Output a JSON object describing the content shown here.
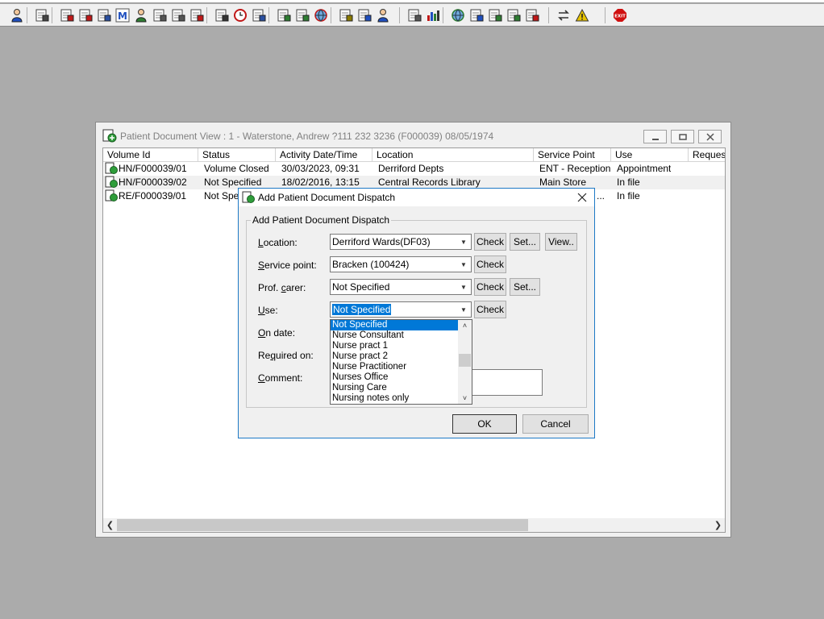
{
  "toolbar": {
    "icons": [
      {
        "name": "patient-icon",
        "color": "#1f4fbf"
      },
      {
        "name": "printer-icon",
        "color": "#444444"
      },
      {
        "name": "red-book-icon",
        "color": "#c01818"
      },
      {
        "name": "folder-icon",
        "color": "#c01818"
      },
      {
        "name": "search-document-icon",
        "color": "#2a4fa0"
      },
      {
        "name": "letter-m-icon",
        "color": "#1f4fbf"
      },
      {
        "name": "person-icon",
        "color": "#2e7d32"
      },
      {
        "name": "edit-document-icon",
        "color": "#555555"
      },
      {
        "name": "transfer-icon",
        "color": "#555555"
      },
      {
        "name": "transfer-red-icon",
        "color": "#c01818"
      },
      {
        "name": "search-icon",
        "color": "#333333"
      },
      {
        "name": "clock-icon",
        "color": "#c01818"
      },
      {
        "name": "screen-icon",
        "color": "#2a4fa0"
      },
      {
        "name": "printer-green-icon",
        "color": "#2e7d32"
      },
      {
        "name": "form-icon",
        "color": "#2e7d32"
      },
      {
        "name": "globe-icon",
        "color": "#c01818"
      },
      {
        "name": "notes-icon",
        "color": "#8a7a00"
      },
      {
        "name": "tray-icon",
        "color": "#1f4fbf"
      },
      {
        "name": "print-person-icon",
        "color": "#1f4fbf"
      },
      {
        "name": "page-icon",
        "color": "#555555"
      },
      {
        "name": "bar-chart-icon",
        "color": "#c01818"
      },
      {
        "name": "globe-arrows-icon",
        "color": "#2e7d32"
      },
      {
        "name": "document-arrow-icon",
        "color": "#1f4fbf"
      },
      {
        "name": "download-icon",
        "color": "#2e7d32"
      },
      {
        "name": "sync-icon",
        "color": "#2e7d32"
      },
      {
        "name": "sync-red-icon",
        "color": "#c01818"
      },
      {
        "name": "swap-icon",
        "color": "#333333"
      },
      {
        "name": "warning-icon",
        "color": "#e6c200"
      },
      {
        "name": "exit-icon",
        "color": "#d01010"
      }
    ],
    "exit_label": "EXIT"
  },
  "child_window": {
    "title": "Patient Document View : 1 - Waterstone, Andrew ?111 232 3236 (F000039) 08/05/1974",
    "columns": [
      "Volume Id",
      "Status",
      "Activity Date/Time",
      "Location",
      "Service Point",
      "Use",
      "Reques"
    ],
    "rows": [
      {
        "volume_id": "HN/F000039/01",
        "status": "Volume Closed",
        "activity": "30/03/2023, 09:31",
        "location": "Derriford Depts",
        "service_point": "ENT - Reception",
        "use": "Appointment"
      },
      {
        "volume_id": "HN/F000039/02",
        "status": "Not Specified",
        "activity": "18/02/2016, 13:15",
        "location": "Central Records Library",
        "service_point": "Main Store",
        "use": "In file"
      },
      {
        "volume_id": "RE/F000039/01",
        "status": "Not Spec",
        "activity": "",
        "location": "",
        "service_point": "...",
        "use": "In file"
      }
    ]
  },
  "dialog": {
    "title": "Add Patient Document Dispatch",
    "group_label": "Add Patient Document Dispatch",
    "fields": {
      "location": {
        "label_u": "L",
        "label_rest": "ocation:",
        "value": "Derriford Wards(DF03)"
      },
      "service_point": {
        "label_u": "S",
        "label_rest": "ervice point:",
        "value": "Bracken (100424)"
      },
      "prof_carer": {
        "label_pre": "Prof. ",
        "label_u": "c",
        "label_rest": "arer:",
        "value": "Not Specified"
      },
      "use": {
        "label_u": "U",
        "label_rest": "se:",
        "value": "Not Specified"
      },
      "on_date": {
        "label_u": "O",
        "label_rest": "n date:"
      },
      "required_on": {
        "label_pre": "Re",
        "label_u": "q",
        "label_rest": "uired on:"
      },
      "comment": {
        "label_u": "C",
        "label_rest": "omment:"
      }
    },
    "buttons": {
      "check": "Check",
      "set": "Set...",
      "view": "View..",
      "ok": "OK",
      "cancel": "Cancel"
    },
    "use_options": [
      "Not Specified",
      "Nurse Consultant",
      "Nurse pract 1",
      "Nurse pract 2",
      "Nurse Practitioner",
      "Nurses Office",
      "Nursing Care",
      "Nursing notes only"
    ]
  }
}
